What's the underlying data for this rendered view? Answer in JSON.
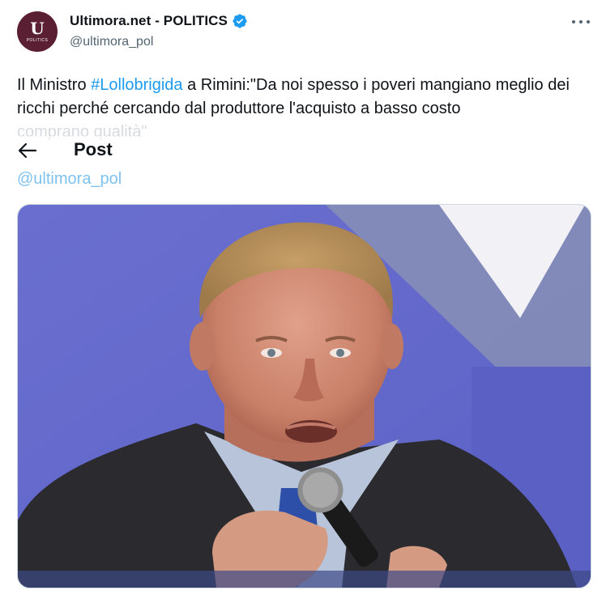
{
  "account": {
    "display_name": "Ultimora.net - POLITICS",
    "handle": "@ultimora_pol",
    "avatar_monogram": "U",
    "avatar_subtext": "POLITICS",
    "verified_icon": "verified-badge-icon",
    "avatar_color": "#5a1f33"
  },
  "tweet": {
    "text_prefix": "Il Ministro ",
    "hashtag": "#Lollobrigida",
    "text_main": " a Rimini:\"Da noi spesso i poveri mangiano meglio dei ricchi perché cercando dal produttore l'acquisto a basso costo",
    "text_faded": "comprano qualità\""
  },
  "overlay": {
    "title": "Post",
    "back_icon": "back-arrow-icon",
    "handle_faded": "@ultimora_pol"
  },
  "colors": {
    "link": "#1d9bf0",
    "verified": "#1d9bf0",
    "secondary_text": "#536471"
  },
  "media": {
    "description_icon": "photo-image"
  }
}
